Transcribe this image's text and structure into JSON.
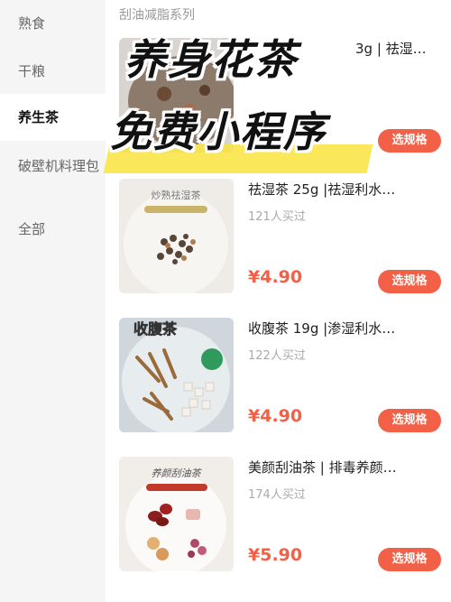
{
  "sidebar": {
    "items": [
      {
        "label": "熟食"
      },
      {
        "label": "干粮"
      },
      {
        "label": "养生茶"
      },
      {
        "label": "破壁机料理包"
      },
      {
        "label": "全部"
      }
    ]
  },
  "section": {
    "title": "刮油减脂系列"
  },
  "promo": {
    "line1": "养身花茶",
    "line2": "免费小程序"
  },
  "products": [
    {
      "name": "3g | 祛湿…",
      "sold": "",
      "price": "",
      "button": "选规格",
      "thumb_label": ""
    },
    {
      "name": "祛湿茶 25g |祛湿利水…",
      "sold": "121人买过",
      "price": "¥4.90",
      "button": "选规格",
      "thumb_label": "炒熟祛湿茶"
    },
    {
      "name": "收腹茶 19g |渗湿利水…",
      "sold": "122人买过",
      "price": "¥4.90",
      "button": "选规格",
      "thumb_label": "收腹茶"
    },
    {
      "name": "美颜刮油茶 | 排毒养颜…",
      "sold": "174人买过",
      "price": "¥5.90",
      "button": "选规格",
      "thumb_label": "养颜刮油茶"
    }
  ],
  "colors": {
    "accent": "#f26047",
    "highlight": "#f9e43d",
    "sidebar_bg": "#f5f5f5"
  }
}
